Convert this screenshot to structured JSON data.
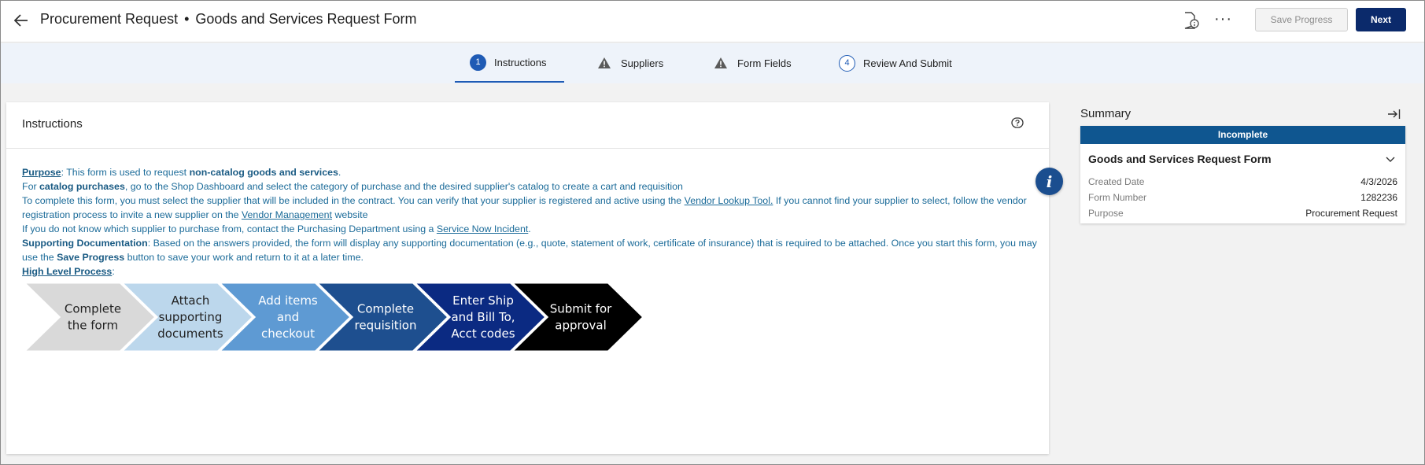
{
  "header": {
    "title": "Procurement Request",
    "separator": "•",
    "subtitle": "Goods and Services Request Form",
    "save_label": "Save Progress",
    "next_label": "Next"
  },
  "steps": [
    {
      "label": "Instructions",
      "num": "1",
      "state": "active"
    },
    {
      "label": "Suppliers",
      "state": "warning"
    },
    {
      "label": "Form Fields",
      "state": "warning"
    },
    {
      "label": "Review And Submit",
      "num": "4",
      "state": "pending"
    }
  ],
  "instructions": {
    "title": "Instructions",
    "purpose_label": "Purpose",
    "purpose_text": ": This form is used to request ",
    "purpose_bold": "non-catalog goods and services",
    "purpose_end": ".",
    "catalog_pre": "For ",
    "catalog_bold": "catalog purchases",
    "catalog_text": ", go to the Shop Dashboard and select the category of purchase and the desired supplier's catalog to create a cart and requisition",
    "complete_text": "To complete this form, you must select the supplier that will be included in the contract. You can verify that your supplier is registered and active using the ",
    "vendor_lookup_link": "Vendor Lookup Tool.",
    "complete_text2": " If you cannot find your supplier to select, follow the vendor registration process to invite a new supplier on the ",
    "vendor_mgmt_link": "Vendor Management",
    "complete_text3": " website",
    "unknown_text": "If you do not know which supplier to purchase from, contact the Purchasing Department using a ",
    "service_now_link": "Service Now Incident",
    "unknown_end": ".",
    "support_label": "Supporting Documentation",
    "support_text": ": Based on the answers provided, the form will display any supporting documentation (e.g., quote, statement of work, certificate of insurance) that is required to be attached. Once you start this form, you may use the ",
    "support_bold": "Save Progress",
    "support_end": " button to save your work and return to it at a later time.",
    "process_label": "High Level Process",
    "process_colon": ":"
  },
  "process_steps": [
    {
      "lines": [
        "Complete",
        "the form"
      ],
      "fill": "#d9d9d9",
      "text": "#222222"
    },
    {
      "lines": [
        "Attach",
        "supporting",
        "documents"
      ],
      "fill": "#bcd7ec",
      "text": "#222222"
    },
    {
      "lines": [
        "Add items",
        "and",
        "checkout"
      ],
      "fill": "#5e9ad3",
      "text": "#ffffff"
    },
    {
      "lines": [
        "Complete",
        "requisition"
      ],
      "fill": "#1e4f8f",
      "text": "#ffffff"
    },
    {
      "lines": [
        "Enter Ship",
        "and Bill To,",
        "Acct codes"
      ],
      "fill": "#0b2a82",
      "text": "#ffffff"
    },
    {
      "lines": [
        "Submit for",
        "approval"
      ],
      "fill": "#000000",
      "text": "#ffffff"
    }
  ],
  "summary": {
    "title": "Summary",
    "status": "Incomplete",
    "form_name": "Goods and Services Request Form",
    "rows": [
      {
        "label": "Created Date",
        "value": "4/3/2026"
      },
      {
        "label": "Form Number",
        "value": "1282236"
      },
      {
        "label": "Purpose",
        "value": "Procurement Request"
      }
    ]
  },
  "colors": {
    "primary": "#0b2a6b",
    "accent": "#1f5bb5",
    "status_badge": "#0f5690"
  },
  "icons": [
    "back-arrow-icon",
    "document-info-icon",
    "more-options-icon",
    "warning-icon",
    "help-icon",
    "info-icon",
    "collapse-panel-icon",
    "chevron-down-icon"
  ]
}
